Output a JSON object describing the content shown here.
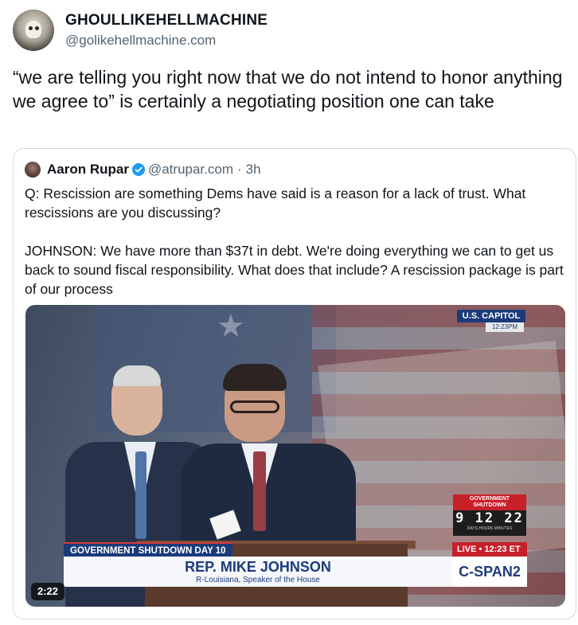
{
  "post": {
    "author": {
      "display_name": "GHOULLIKEHELLMACHINE",
      "handle": "@golikehellmachine.com"
    },
    "text": "“we are telling you right now that we do not intend to honor anything we agree to” is certainly a negotiating position one can take"
  },
  "quote": {
    "author": {
      "display_name": "Aaron Rupar",
      "handle": "@atrupar.com",
      "separator": "·",
      "time": "3h"
    },
    "text": "Q: Rescission are something Dems have said is a reason for a lack of trust. What rescissions are you discussing?\n\nJOHNSON: We have more than $37t in debt. We're doing everything we can to get us back to sound fiscal responsibility. What does that include? A rescission package is part of our process",
    "video": {
      "duration": "2:22",
      "overlay": {
        "location": "U.S. CAPITOL",
        "location_time": "12:23PM",
        "chyron_tag": "GOVERNMENT SHUTDOWN DAY 10",
        "chyron_name": "REP. MIKE JOHNSON",
        "chyron_sub": "R-Louisiana, Speaker of the House",
        "live_label": "LIVE • 12:23 ET",
        "network": "C-SPAN2",
        "shutdown_label": "GOVERNMENT SHUTDOWN",
        "shutdown_time": "9 12 22",
        "shutdown_units": "DAYS HOURS MINUTES"
      }
    }
  },
  "colors": {
    "text_primary": "#0f1419",
    "text_secondary": "#536471",
    "border": "#cfd9de",
    "verified_blue": "#1d9bf0"
  },
  "icons": {
    "verified": "verified-badge-icon"
  }
}
